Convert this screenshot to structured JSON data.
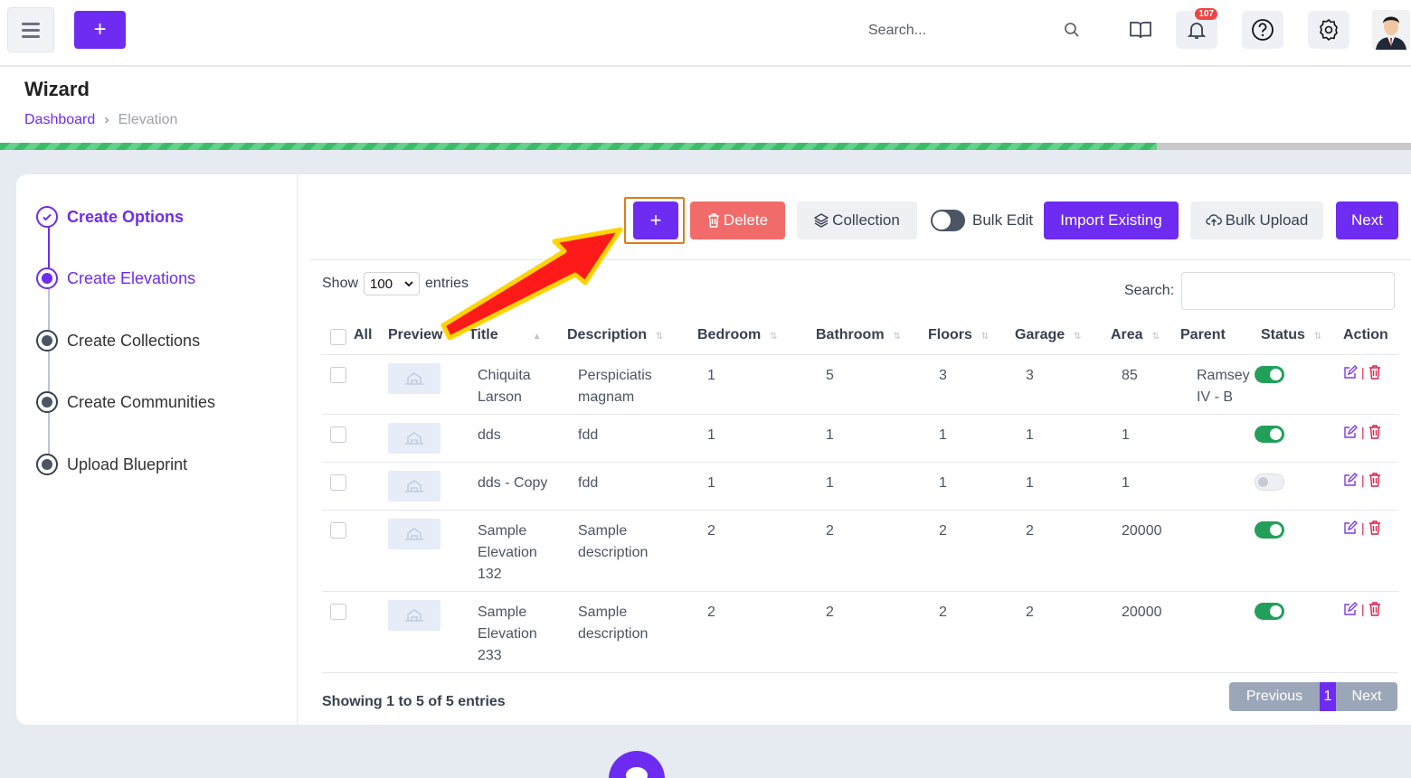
{
  "topbar": {
    "search_placeholder": "Search...",
    "notification_count": "107",
    "icons": [
      "menu-icon",
      "plus-icon",
      "search-icon",
      "book-icon",
      "bell-icon",
      "help-icon",
      "gear-icon",
      "avatar"
    ]
  },
  "page": {
    "title": "Wizard",
    "breadcrumb": [
      "Dashboard",
      "Elevation"
    ],
    "progress_percent": 82
  },
  "steps": [
    {
      "label": "Create Options",
      "state": "done"
    },
    {
      "label": "Create Elevations",
      "state": "current"
    },
    {
      "label": "Create Collections",
      "state": "pending"
    },
    {
      "label": "Create Communities",
      "state": "pending"
    },
    {
      "label": "Upload Blueprint",
      "state": "pending"
    }
  ],
  "toolbar": {
    "add_label": "+",
    "delete_label": "Delete",
    "collection_label": "Collection",
    "bulk_edit_label": "Bulk Edit",
    "import_label": "Import Existing",
    "bulk_upload_label": "Bulk Upload",
    "next_label": "Next"
  },
  "table_controls": {
    "show_label": "Show",
    "entries_value": "100",
    "entries_label": "entries",
    "search_label": "Search:"
  },
  "table": {
    "headers": {
      "all": "All",
      "preview": "Preview",
      "title": "Title",
      "description": "Description",
      "bedroom": "Bedroom",
      "bathroom": "Bathroom",
      "floors": "Floors",
      "garage": "Garage",
      "area": "Area",
      "parent": "Parent",
      "status": "Status",
      "action": "Action"
    },
    "rows": [
      {
        "title": [
          "Chiquita",
          "Larson"
        ],
        "description": [
          "Perspiciatis",
          "magnam"
        ],
        "bedroom": "1",
        "bathroom": "5",
        "floors": "3",
        "garage": "3",
        "area": "85",
        "parent": [
          "Ramsey",
          "IV - B"
        ],
        "status": true
      },
      {
        "title": [
          "dds"
        ],
        "description": [
          "fdd"
        ],
        "bedroom": "1",
        "bathroom": "1",
        "floors": "1",
        "garage": "1",
        "area": "1",
        "parent": [],
        "status": true
      },
      {
        "title": [
          "dds - Copy"
        ],
        "description": [
          "fdd"
        ],
        "bedroom": "1",
        "bathroom": "1",
        "floors": "1",
        "garage": "1",
        "area": "1",
        "parent": [],
        "status": false
      },
      {
        "title": [
          "Sample",
          "Elevation",
          "132"
        ],
        "description": [
          "Sample",
          "description"
        ],
        "bedroom": "2",
        "bathroom": "2",
        "floors": "2",
        "garage": "2",
        "area": "20000",
        "parent": [],
        "status": true
      },
      {
        "title": [
          "Sample",
          "Elevation",
          "233"
        ],
        "description": [
          "Sample",
          "description"
        ],
        "bedroom": "2",
        "bathroom": "2",
        "floors": "2",
        "garage": "2",
        "area": "20000",
        "parent": [],
        "status": true
      }
    ]
  },
  "footer": {
    "info": "Showing 1 to 5 of 5 entries",
    "prev_label": "Previous",
    "page": "1",
    "next_label": "Next"
  },
  "colors": {
    "accent": "#6e2cf2",
    "delete": "#f26b6b",
    "success": "#22a05a",
    "progress": "#3dbb6b",
    "annotation_arrow": "#ff1a1a",
    "annotation_outline": "#ffd400"
  }
}
